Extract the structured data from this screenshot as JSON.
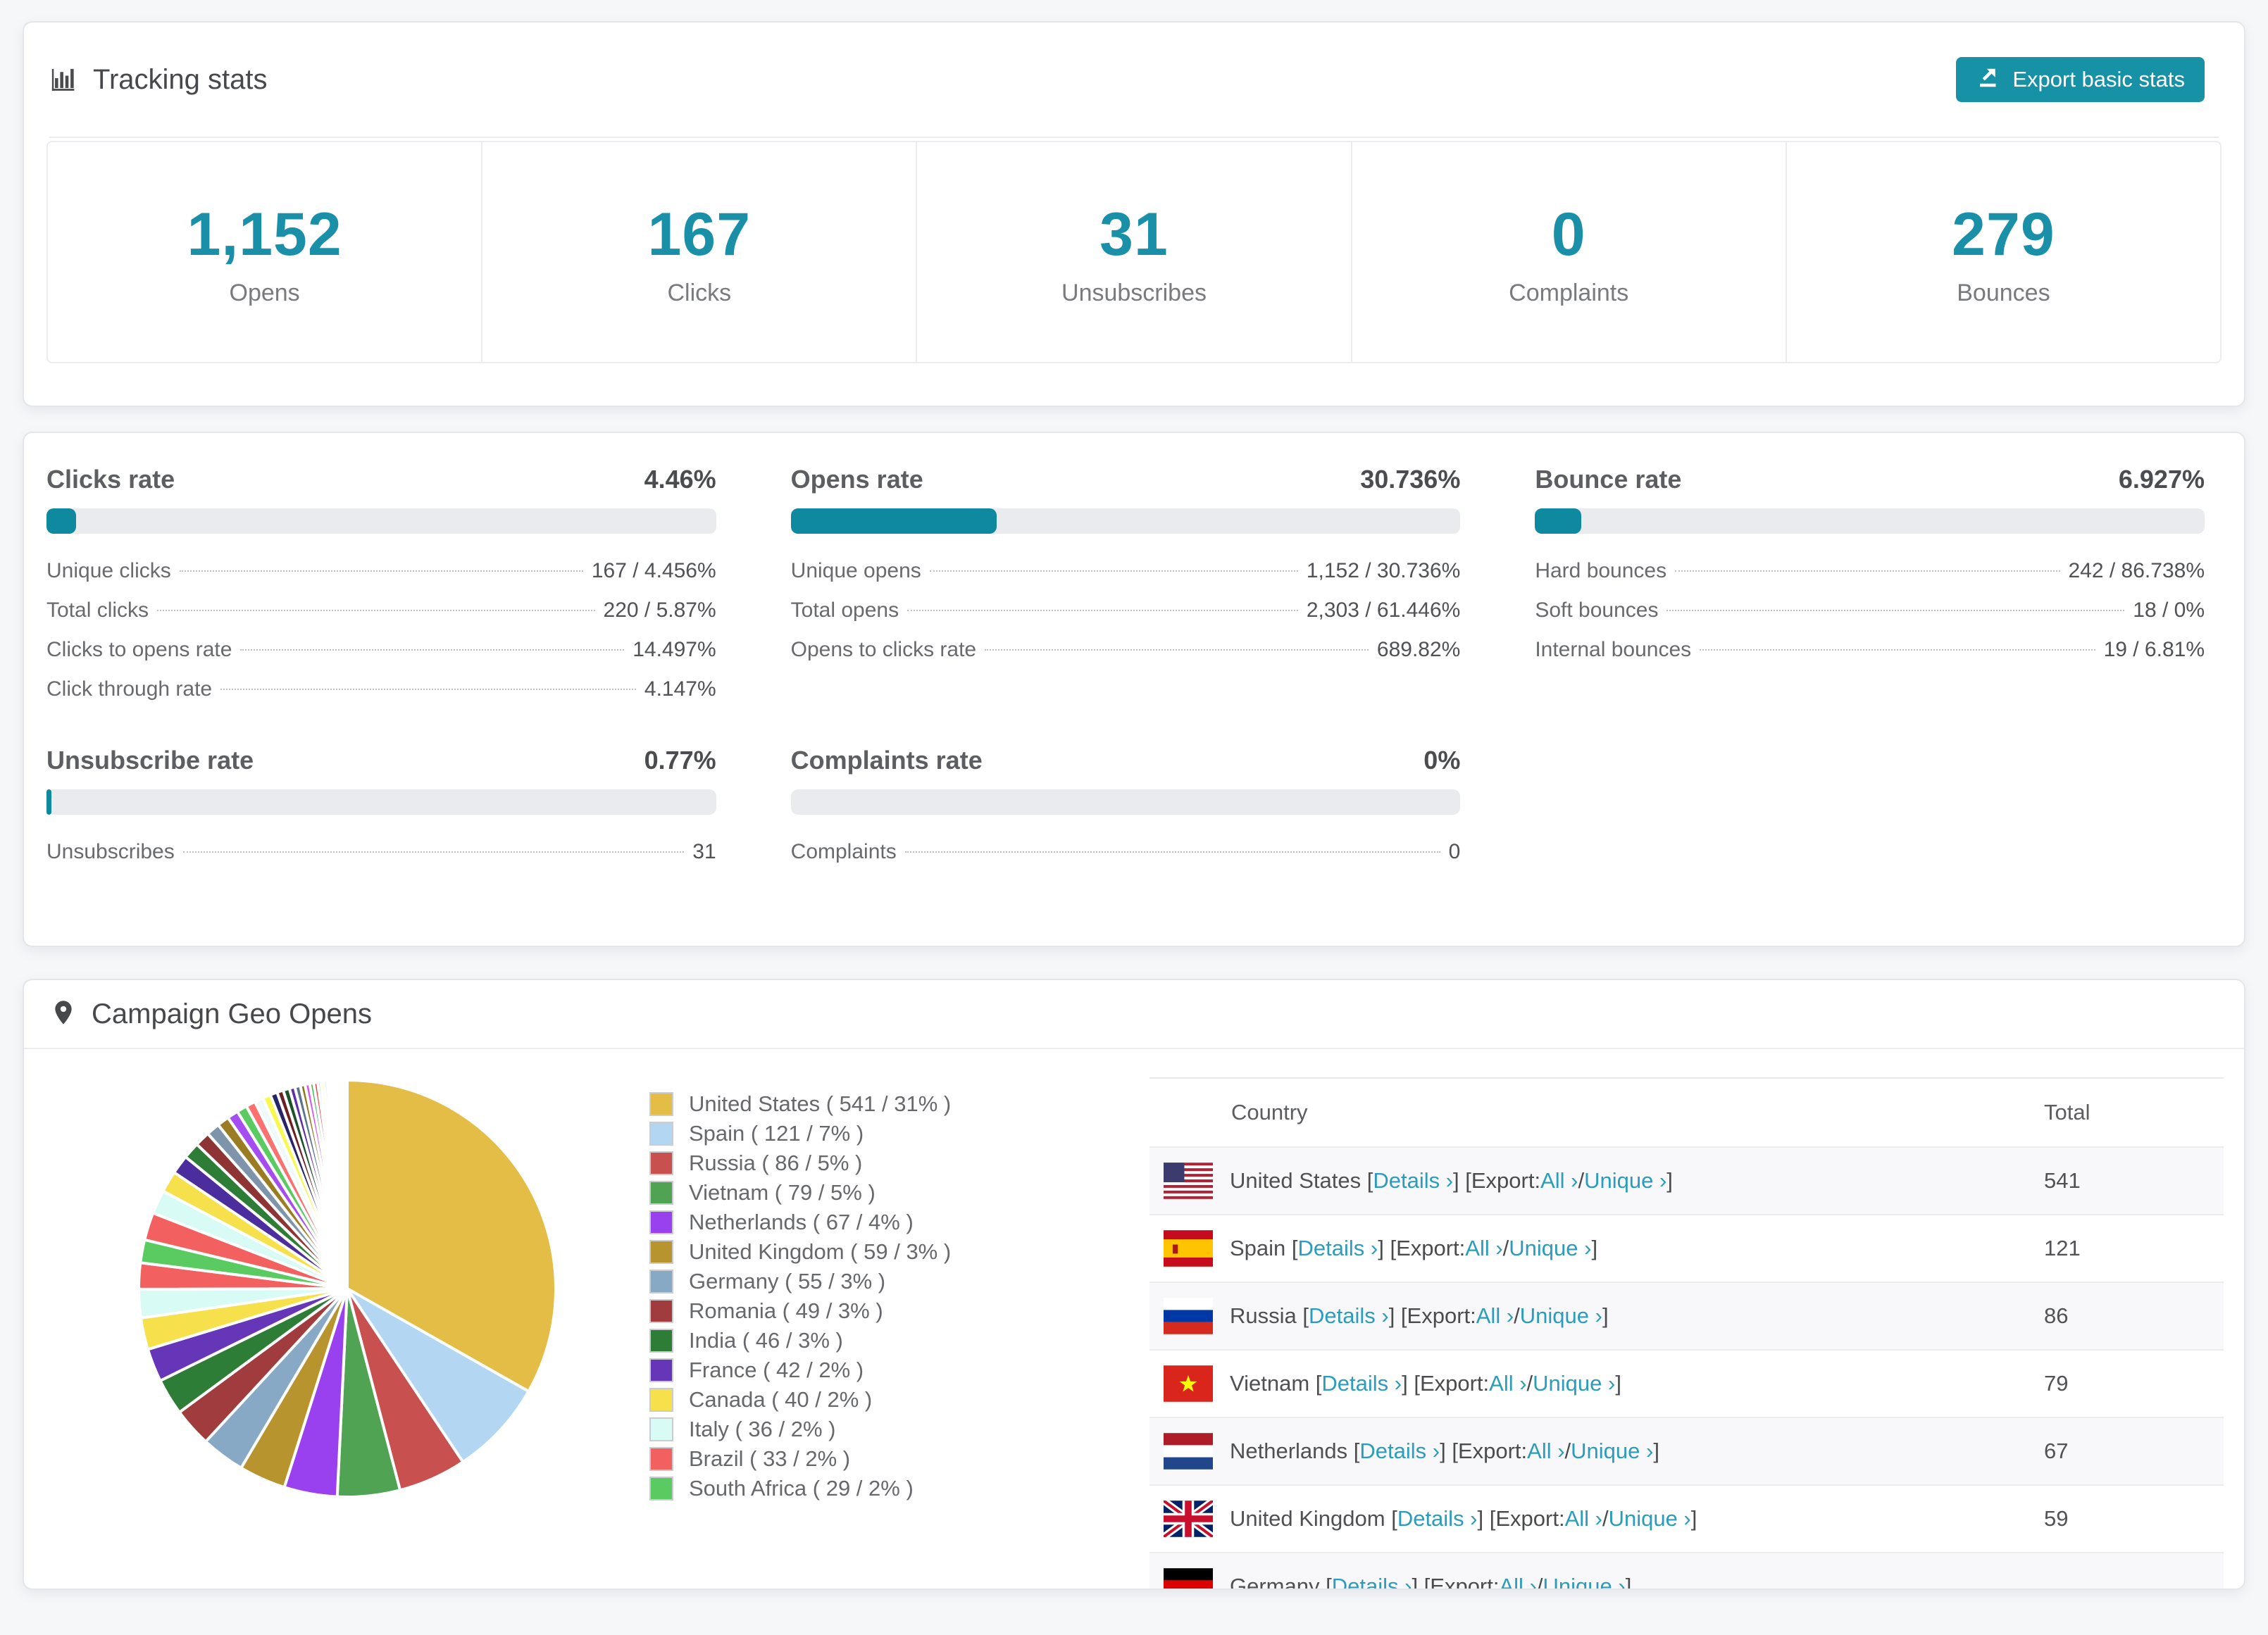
{
  "header": {
    "title": "Tracking stats",
    "export_label": "Export basic stats"
  },
  "accent_colors": {
    "teal": "#1a8fa8",
    "bar_fill": "#0f89a0",
    "link": "#2b9cbb"
  },
  "summary": {
    "items": [
      {
        "value": "1,152",
        "label": "Opens"
      },
      {
        "value": "167",
        "label": "Clicks"
      },
      {
        "value": "31",
        "label": "Unsubscribes"
      },
      {
        "value": "0",
        "label": "Complaints"
      },
      {
        "value": "279",
        "label": "Bounces"
      }
    ]
  },
  "rates": {
    "blocks": [
      {
        "title": "Clicks rate",
        "value": "4.46%",
        "bar_percent": 4.46,
        "rows": [
          {
            "label": "Unique clicks",
            "value": "167 / 4.456%"
          },
          {
            "label": "Total clicks",
            "value": "220 / 5.87%"
          },
          {
            "label": "Clicks to opens rate",
            "value": "14.497%"
          },
          {
            "label": "Click through rate",
            "value": "4.147%"
          }
        ]
      },
      {
        "title": "Opens rate",
        "value": "30.736%",
        "bar_percent": 30.736,
        "rows": [
          {
            "label": "Unique opens",
            "value": "1,152 / 30.736%"
          },
          {
            "label": "Total opens",
            "value": "2,303 / 61.446%"
          },
          {
            "label": "Opens to clicks rate",
            "value": "689.82%"
          }
        ]
      },
      {
        "title": "Bounce rate",
        "value": "6.927%",
        "bar_percent": 6.927,
        "rows": [
          {
            "label": "Hard bounces",
            "value": "242 / 86.738%"
          },
          {
            "label": "Soft bounces",
            "value": "18 / 0%"
          },
          {
            "label": "Internal bounces",
            "value": "19 / 6.81%"
          }
        ]
      },
      {
        "title": "Unsubscribe rate",
        "value": "0.77%",
        "bar_percent": 0.77,
        "rows": [
          {
            "label": "Unsubscribes",
            "value": "31"
          }
        ]
      },
      {
        "title": "Complaints rate",
        "value": "0%",
        "bar_percent": 0,
        "rows": [
          {
            "label": "Complaints",
            "value": "0"
          }
        ]
      }
    ]
  },
  "geo": {
    "title": "Campaign Geo Opens",
    "legend": [
      {
        "label": "United States ( 541 / 31% )",
        "color": "#e4bd47"
      },
      {
        "label": "Spain ( 121 / 7% )",
        "color": "#b3d6f2"
      },
      {
        "label": "Russia ( 86 / 5% )",
        "color": "#c8504f"
      },
      {
        "label": "Vietnam ( 79 / 5% )",
        "color": "#4fa353"
      },
      {
        "label": "Netherlands ( 67 / 4% )",
        "color": "#9a41ef"
      },
      {
        "label": "United Kingdom ( 59 / 3% )",
        "color": "#b8942f"
      },
      {
        "label": "Germany ( 55 / 3% )",
        "color": "#88a9c6"
      },
      {
        "label": "Romania ( 49 / 3% )",
        "color": "#a03c3d"
      },
      {
        "label": "India ( 46 / 3% )",
        "color": "#2e7d36"
      },
      {
        "label": "France ( 42 / 2% )",
        "color": "#6636b8"
      },
      {
        "label": "Canada ( 40 / 2% )",
        "color": "#f6e14c"
      },
      {
        "label": "Italy ( 36 / 2% )",
        "color": "#d9fbf6"
      },
      {
        "label": "Brazil ( 33 / 2% )",
        "color": "#f2615f"
      },
      {
        "label": "South Africa ( 29 / 2% )",
        "color": "#59cb60"
      }
    ],
    "table": {
      "col_country": "Country",
      "col_total": "Total",
      "row_template": {
        "open": "[",
        "details": "Details ›",
        "mid": "] [Export: ",
        "all": "All ›",
        "slash": " / ",
        "unique": "Unique ›",
        "close": "]"
      },
      "rows": [
        {
          "country": "United States",
          "total": "541",
          "flag": "us"
        },
        {
          "country": "Spain",
          "total": "121",
          "flag": "es"
        },
        {
          "country": "Russia",
          "total": "86",
          "flag": "ru"
        },
        {
          "country": "Vietnam",
          "total": "79",
          "flag": "vn"
        },
        {
          "country": "Netherlands",
          "total": "67",
          "flag": "nl"
        },
        {
          "country": "United Kingdom",
          "total": "59",
          "flag": "gb"
        },
        {
          "country": "Germany",
          "total": "",
          "flag": "de"
        }
      ]
    }
  },
  "chart_data": {
    "type": "pie",
    "title": "Campaign Geo Opens",
    "legend_position": "right",
    "categories": [
      "United States",
      "Spain",
      "Russia",
      "Vietnam",
      "Netherlands",
      "United Kingdom",
      "Germany",
      "Romania",
      "India",
      "France",
      "Canada",
      "Italy",
      "Brazil",
      "South Africa"
    ],
    "values": [
      541,
      121,
      86,
      79,
      67,
      59,
      55,
      49,
      46,
      42,
      40,
      36,
      33,
      29
    ],
    "percent_labels": [
      "31%",
      "7%",
      "5%",
      "5%",
      "4%",
      "3%",
      "3%",
      "3%",
      "3%",
      "2%",
      "2%",
      "2%",
      "2%",
      "2%"
    ],
    "colors": [
      "#e4bd47",
      "#b3d6f2",
      "#c8504f",
      "#4fa353",
      "#9a41ef",
      "#b8942f",
      "#88a9c6",
      "#a03c3d",
      "#2e7d36",
      "#6636b8",
      "#f6e14c",
      "#d9fbf6",
      "#f2615f",
      "#59cb60"
    ],
    "other_values": [
      35,
      30,
      27,
      24,
      21,
      19,
      17,
      15,
      14,
      13,
      12,
      11,
      10,
      9,
      8,
      8,
      7,
      7,
      6,
      6,
      5,
      5,
      4,
      4,
      4,
      3,
      3,
      3,
      2,
      2,
      2,
      2,
      1,
      1,
      1,
      1,
      1,
      1,
      1,
      1
    ],
    "other_colors": [
      "#f2615f",
      "#d9fbf6",
      "#f6e14c",
      "#4b2d9e",
      "#2e7d36",
      "#8f3434",
      "#7d94ab",
      "#9a7d22",
      "#a64df2",
      "#59cb60",
      "#fb7171",
      "#eef9fb",
      "#f8f84f",
      "#26246b",
      "#6d2024",
      "#1d5128",
      "#5f2fa8",
      "#5a748c",
      "#8a7a1e",
      "#d45bf0",
      "#37b34a",
      "#e8413f",
      "#7ee68a",
      "#fdfd62",
      "#bcdcf8",
      "#c9a43a",
      "#f2615f",
      "#4fa353",
      "#9a41ef",
      "#b3d6f2",
      "#e4bd47",
      "#c8504f",
      "#59cb60",
      "#f6e14c",
      "#6636b8",
      "#2e7d36",
      "#88a9c6",
      "#a03c3d",
      "#d9fbf6",
      "#fb7171"
    ],
    "start_angle_deg": 0,
    "direction": "clockwise"
  }
}
